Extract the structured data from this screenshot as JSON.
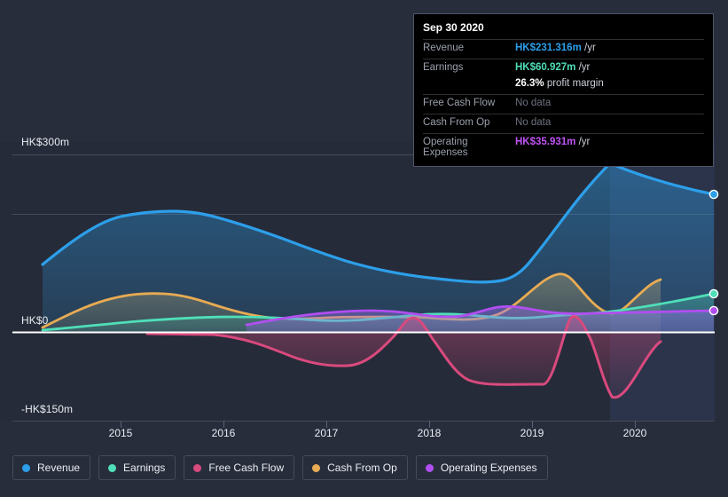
{
  "theme": {
    "background": "#282d3c",
    "plot_background": "#262b39",
    "future_band_background": "#2b3347",
    "grid_color": "#454b5c",
    "zero_line_color": "#ffffff",
    "axis_text_color": "#e9ecf2"
  },
  "axes": {
    "y_labels": [
      "HK$300m",
      "HK$0",
      "-HK$150m"
    ],
    "x_labels": [
      "2015",
      "2016",
      "2017",
      "2018",
      "2019",
      "2020"
    ]
  },
  "tooltip": {
    "date": "Sep 30 2020",
    "rows": [
      {
        "label": "Revenue",
        "value": "HK$231.316m",
        "unit": "/yr",
        "color": "#2d9fea",
        "nodata": false
      },
      {
        "label": "Earnings",
        "value": "HK$60.927m",
        "unit": "/yr",
        "color": "#4fdfb8",
        "nodata": false
      },
      {
        "label": "",
        "value": "26.3%",
        "unit": "profit margin",
        "color": "#ffffff",
        "nodata": false,
        "sub": true
      },
      {
        "label": "Free Cash Flow",
        "value": "No data",
        "unit": "",
        "color": "#6d7280",
        "nodata": true
      },
      {
        "label": "Cash From Op",
        "value": "No data",
        "unit": "",
        "color": "#6d7280",
        "nodata": true
      },
      {
        "label": "Operating Expenses",
        "value": "HK$35.931m",
        "unit": "/yr",
        "color": "#c052f5",
        "nodata": false
      }
    ]
  },
  "legend": {
    "items": [
      {
        "label": "Revenue",
        "color": "#2d9fea"
      },
      {
        "label": "Earnings",
        "color": "#4fdfb8"
      },
      {
        "label": "Free Cash Flow",
        "color": "#d94a7e"
      },
      {
        "label": "Cash From Op",
        "color": "#e8ab53"
      },
      {
        "label": "Operating Expenses",
        "color": "#b14ef0"
      }
    ]
  },
  "chart_data": {
    "type": "area",
    "title": "",
    "xlabel": "",
    "ylabel": "HK$",
    "currency": "HK$",
    "units": "millions",
    "ylim": [
      -150,
      300
    ],
    "y_ticks": [
      300,
      0,
      -150
    ],
    "grid": true,
    "legend_position": "bottom",
    "x": [
      "2014.5",
      "2015",
      "2015.5",
      "2016",
      "2016.5",
      "2017",
      "2017.5",
      "2018",
      "2018.5",
      "2019",
      "2019.5",
      "2020",
      "2020.75"
    ],
    "series": [
      {
        "name": "Revenue",
        "color": "#2d9fea",
        "fill": true,
        "values": [
          115,
          175,
          194,
          196,
          185,
          170,
          152,
          140,
          137,
          200,
          286,
          265,
          231
        ]
      },
      {
        "name": "Earnings",
        "color": "#4fdfb8",
        "fill": true,
        "values": [
          4,
          12,
          20,
          24,
          20,
          14,
          18,
          26,
          20,
          20,
          28,
          40,
          61
        ]
      },
      {
        "name": "Free Cash Flow",
        "color": "#d94a7e",
        "fill": true,
        "values": [
          null,
          null,
          -2,
          -8,
          -35,
          -57,
          -40,
          24,
          -5,
          -88,
          -88,
          -113,
          -17
        ]
      },
      {
        "name": "Cash From Op",
        "color": "#e8ab53",
        "fill": true,
        "values": [
          8,
          40,
          58,
          62,
          50,
          34,
          30,
          30,
          26,
          88,
          50,
          22,
          62
        ]
      },
      {
        "name": "Operating Expenses",
        "color": "#b14ef0",
        "fill": true,
        "values": [
          null,
          null,
          null,
          null,
          12,
          22,
          30,
          34,
          28,
          34,
          34,
          36,
          36
        ]
      }
    ],
    "end_markers": [
      {
        "series": "Revenue",
        "value": 231.316
      },
      {
        "series": "Earnings",
        "value": 60.927
      },
      {
        "series": "Operating Expenses",
        "value": 35.931
      }
    ],
    "annotations": {
      "forecast_divider_x": "2019.7"
    }
  }
}
